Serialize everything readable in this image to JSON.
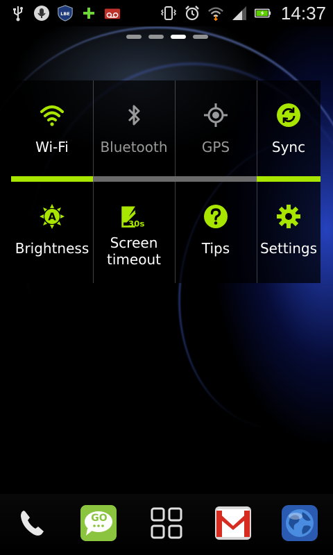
{
  "status_bar": {
    "time": "14:37",
    "left_icons": [
      "usb-icon",
      "microphone-icon",
      "lbe-shield-icon",
      "add-icon",
      "voicemail-icon"
    ],
    "lbe_text": "LBE",
    "right_icons": [
      "vibrate-icon",
      "alarm-icon",
      "wifi-signal-icon",
      "cell-signal-icon",
      "battery-charging-icon"
    ]
  },
  "home_pages": {
    "count": 4,
    "active": 3
  },
  "quick_settings": {
    "row1": [
      {
        "label": "Wi-Fi",
        "icon": "wifi-icon",
        "state": "on"
      },
      {
        "label": "Bluetooth",
        "icon": "bluetooth-icon",
        "state": "off"
      },
      {
        "label": "GPS",
        "icon": "gps-icon",
        "state": "off"
      },
      {
        "label": "Sync",
        "icon": "sync-icon",
        "state": "on"
      }
    ],
    "row2": [
      {
        "label": "Brightness",
        "icon": "brightness-auto-icon"
      },
      {
        "label": "Screen\ntimeout",
        "icon": "screen-timeout-icon",
        "icon_text": "30s"
      },
      {
        "label": "Tips",
        "icon": "help-icon"
      },
      {
        "label": "Settings",
        "icon": "settings-gear-icon"
      }
    ]
  },
  "dock": {
    "items": [
      {
        "icon": "phone-icon"
      },
      {
        "icon": "go-sms-icon",
        "icon_text": "GO"
      },
      {
        "icon": "app-drawer-icon"
      },
      {
        "icon": "gmail-icon"
      },
      {
        "icon": "browser-globe-icon"
      }
    ]
  },
  "colors": {
    "accent": "#a8e600",
    "inactive": "#9a9a9a",
    "bar_off": "#6a6a6a"
  }
}
